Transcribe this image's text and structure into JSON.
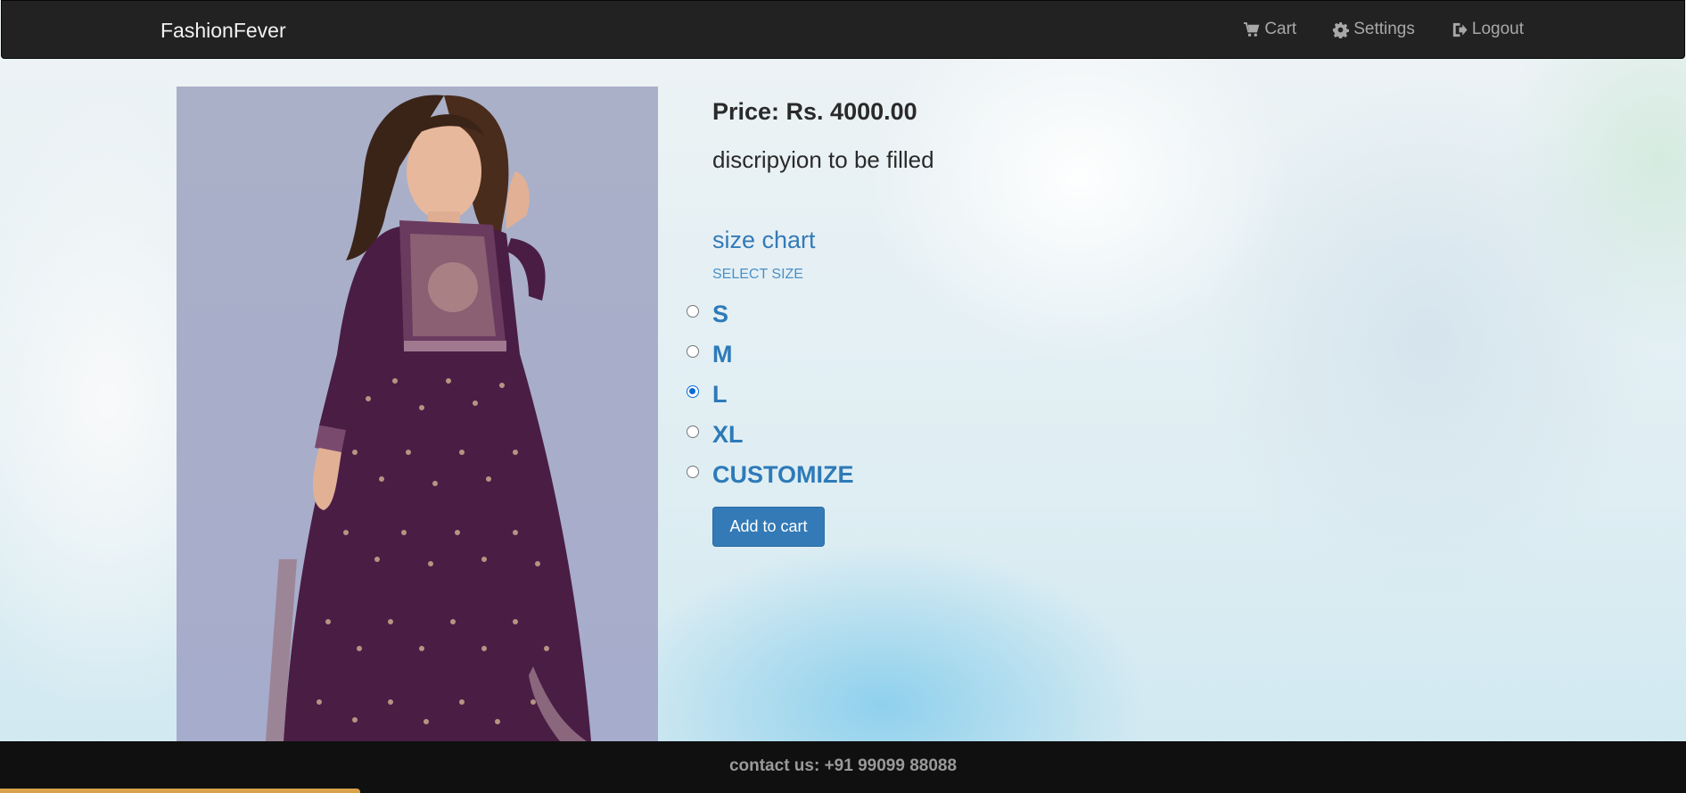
{
  "navbar": {
    "brand": "FashionFever",
    "links": [
      {
        "label": "Cart",
        "icon": "cart-icon"
      },
      {
        "label": "Settings",
        "icon": "gear-icon"
      },
      {
        "label": "Logout",
        "icon": "logout-icon"
      }
    ]
  },
  "product": {
    "price": "Price: Rs. 4000.00",
    "description": "discripyion to be filled",
    "size_chart_label": "size chart",
    "select_size_label": "SELECT SIZE",
    "sizes": [
      {
        "label": "S",
        "checked": false
      },
      {
        "label": "M",
        "checked": false
      },
      {
        "label": "L",
        "checked": true
      },
      {
        "label": "XL",
        "checked": false
      },
      {
        "label": "CUSTOMIZE",
        "checked": false
      }
    ],
    "add_to_cart_label": "Add to cart"
  },
  "footer": {
    "contact": "contact us: +91 99099 88088"
  },
  "colors": {
    "navbar_bg": "#222222",
    "accent_blue": "#337ab7",
    "footer_bg": "#101010",
    "dress": "#4a1d45"
  }
}
